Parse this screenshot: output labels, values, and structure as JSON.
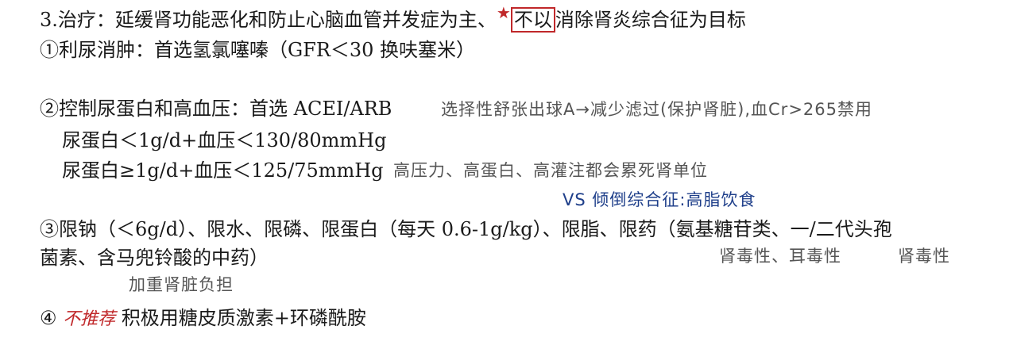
{
  "l1": {
    "text_a": "3.治疗：延缓肾功能恶化和防止心脑血管并发症为主、",
    "star": "★",
    "boxed": "不以",
    "text_b": "消除肾炎综合征为目标"
  },
  "l2": {
    "text": "①利尿消肿：首选氢氯噻嗪（GFR＜30 换呋塞米）"
  },
  "l3": {
    "text": "②控制尿蛋白和高血压：首选 ACEI/ARB",
    "note": "选择性舒张出球A→减少滤过(保护肾脏),血Cr>265禁用"
  },
  "l4": {
    "text": "尿蛋白＜1g/d+血压＜130/80mmHg"
  },
  "l5": {
    "text": "尿蛋白≥1g/d+血压＜125/75mmHg",
    "note": "高压力、高蛋白、高灌注都会累死肾单位"
  },
  "vs": {
    "text": "VS  倾倒综合征:高脂饮食"
  },
  "l6": {
    "text": "③限钠（＜6g/d）、限水、限磷、限蛋白（每天 0.6-1g/kg）、限脂、限药（氨基糖苷类、一/二代头孢"
  },
  "l7": {
    "text": "菌素、含马兜铃酸的中药）",
    "note_a": "肾毒性、耳毒性",
    "note_b": "肾毒性"
  },
  "l8": {
    "note": "加重肾脏负担"
  },
  "l9": {
    "num": "④",
    "highlight": "不推荐",
    "text": "积极用糖皮质激素+环磷酰胺"
  }
}
